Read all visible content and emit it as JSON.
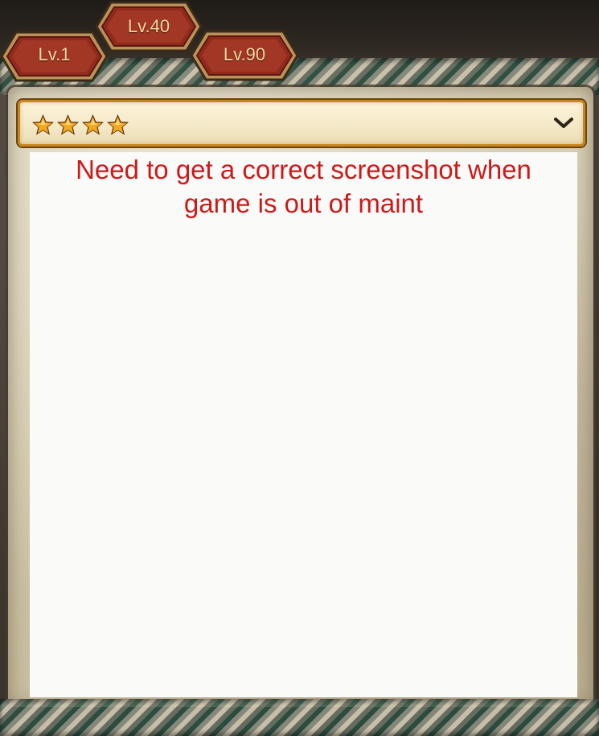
{
  "tabs": [
    {
      "label": "Lv.1"
    },
    {
      "label": "Lv.40"
    },
    {
      "label": "Lv.90"
    }
  ],
  "filter_dropdown": {
    "selected_star_count": 4,
    "icon": "star-icon",
    "expand_icon": "chevron-down-icon"
  },
  "content": {
    "notice": "Need to get a correct screenshot when\ngame is out of maint"
  },
  "colors": {
    "notice_text": "#cc1a1a",
    "tab_fill": "#8f2a1d",
    "tab_text": "#f1d9a0",
    "star_fill": "#f0a823",
    "dropdown_border": "#c8871e"
  }
}
